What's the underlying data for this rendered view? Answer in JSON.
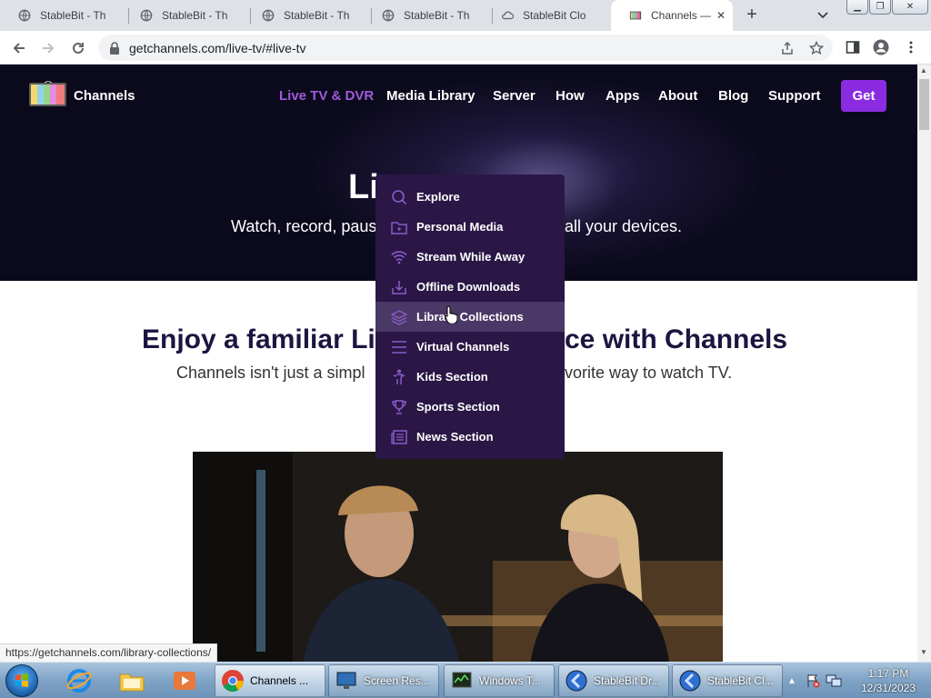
{
  "browser": {
    "tabs": [
      {
        "title": "StableBit - Th"
      },
      {
        "title": "StableBit - Th"
      },
      {
        "title": "StableBit - Th"
      },
      {
        "title": "StableBit - Th"
      },
      {
        "title": "StableBit Clo"
      },
      {
        "title": "Channels —"
      }
    ],
    "active_tab_index": 5,
    "url": "getchannels.com/live-tv/#live-tv",
    "status_url": "https://getchannels.com/library-collections/"
  },
  "site": {
    "brand": "Channels",
    "nav": {
      "live_tv": "Live TV & DVR",
      "media_library": "Media Library",
      "server": "Server",
      "how": "How",
      "apps": "Apps",
      "about": "About",
      "blog": "Blog",
      "support": "Support",
      "get": "Get"
    },
    "hero": {
      "title_visible": "Li",
      "subtitle_left": "Watch, record, paus",
      "subtitle_right": "all your devices."
    },
    "section": {
      "heading_left": "Enjoy a familiar Liv",
      "heading_right": "ce with Channels",
      "para_left": "Channels isn't just a simpl",
      "para_right": "vorite way to watch TV."
    },
    "dropdown": {
      "hovered_index": 4,
      "items": [
        {
          "label": "Explore",
          "icon": "search-icon"
        },
        {
          "label": "Personal Media",
          "icon": "folder-icon"
        },
        {
          "label": "Stream While Away",
          "icon": "wifi-icon"
        },
        {
          "label": "Offline Downloads",
          "icon": "download-icon"
        },
        {
          "label": "Library Collections",
          "icon": "layers-icon"
        },
        {
          "label": "Virtual Channels",
          "icon": "list-icon"
        },
        {
          "label": "Kids Section",
          "icon": "child-icon"
        },
        {
          "label": "Sports Section",
          "icon": "trophy-icon"
        },
        {
          "label": "News Section",
          "icon": "newspaper-icon"
        }
      ]
    }
  },
  "taskbar": {
    "buttons": [
      {
        "label": "Channels ..."
      },
      {
        "label": "Screen Res..."
      },
      {
        "label": "Windows T..."
      },
      {
        "label": "StableBit Dr..."
      },
      {
        "label": "StableBit Cl..."
      }
    ],
    "time": "1:17 PM",
    "date": "12/31/2023"
  },
  "colors": {
    "accent": "#8a2be2",
    "nav_active": "#9e5bd9",
    "hero_bg": "#0b0a1c",
    "dropdown_bg": "#2a1745",
    "heading": "#1e1440"
  }
}
